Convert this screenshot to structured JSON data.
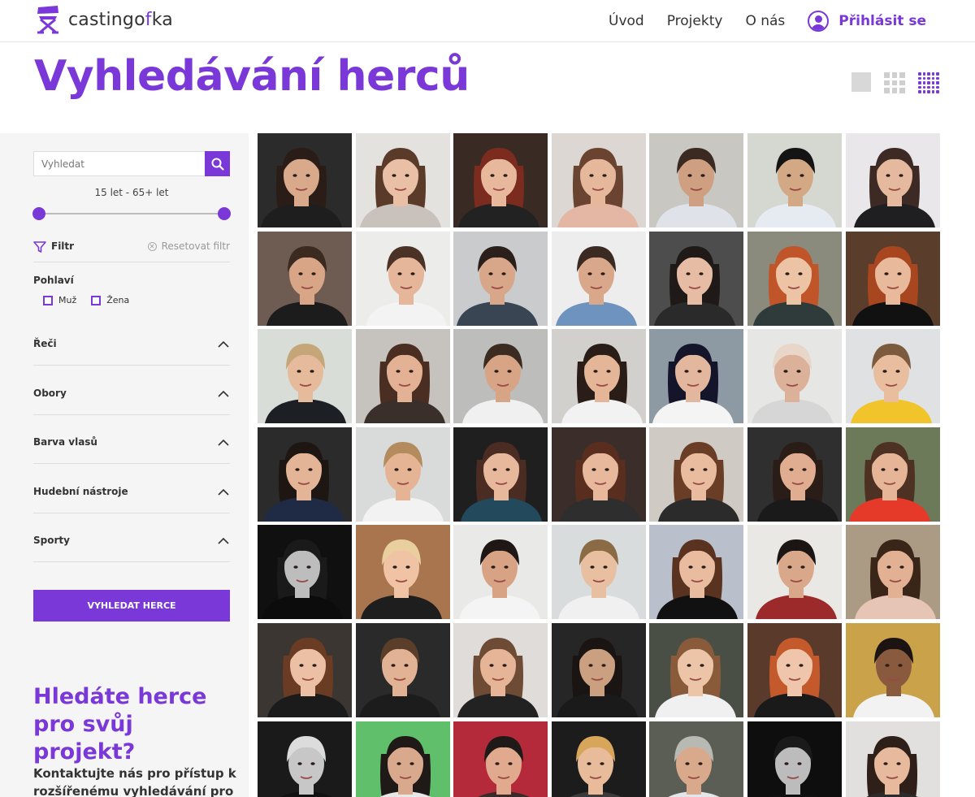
{
  "header": {
    "logo_text_start": "castingo",
    "logo_text_accent": "f",
    "logo_text_end": "ka",
    "nav": [
      "Úvod",
      "Projekty",
      "O nás"
    ],
    "login_label": "Přihlásit se"
  },
  "page": {
    "title": "Vyhledávání herců"
  },
  "sidebar": {
    "search_placeholder": "Vyhledat",
    "age_range": "15 let - 65+ let",
    "age_min": 15,
    "age_max": 65,
    "filter_label": "Filtr",
    "reset_label": "Resetovat filtr",
    "gender_title": "Pohlaví",
    "gender_options": [
      "Muž",
      "Žena"
    ],
    "accordions": [
      "Řeči",
      "Obory",
      "Barva vlasů",
      "Hudební nástroje",
      "Sporty"
    ],
    "cta_label": "VYHLEDAT HERCE",
    "promo_title": "Hledáte herce pro svůj projekt?",
    "promo_text": "Kontaktujte nás pro přístup k rozšířenému vyhledávání pro"
  },
  "colors": {
    "accent": "#7a38d8",
    "sidebar_bg": "#f5f5f5"
  },
  "icons": {
    "search": "search-icon",
    "filter": "filter-icon",
    "reset": "reset-x-icon",
    "login": "user-circle-icon",
    "accordion": "chevron-up-icon",
    "view_large": "view-large-icon",
    "view_medium": "view-grid-3-icon",
    "view_small": "view-grid-5-icon"
  },
  "actors": [
    {
      "bg": "#2b2b2b",
      "skin": "#d9a98c",
      "hair": "#2a1d18",
      "shirt": "#1e1e1e",
      "long": true
    },
    {
      "bg": "#e4e2df",
      "skin": "#e9c0a6",
      "hair": "#5a3b2a",
      "shirt": "#c9c2bc",
      "long": true
    },
    {
      "bg": "#3a2a24",
      "skin": "#e8b89c",
      "hair": "#7c2b1f",
      "shirt": "#222",
      "long": true
    },
    {
      "bg": "#dcd7d2",
      "skin": "#e6b89b",
      "hair": "#6a4430",
      "shirt": "#e4b7a5",
      "long": true
    },
    {
      "bg": "#c8c7c2",
      "skin": "#cf9f82",
      "hair": "#3a2a22",
      "shirt": "#dfe2e8",
      "long": false
    },
    {
      "bg": "#d5d7d1",
      "skin": "#d3a985",
      "hair": "#141414",
      "shirt": "#e6ebf2",
      "long": false
    },
    {
      "bg": "#e9e7ea",
      "skin": "#e5b99e",
      "hair": "#3d2a24",
      "shirt": "#1f1f22",
      "long": true
    },
    {
      "bg": "#6e5c52",
      "skin": "#d9a587",
      "hair": "#3a2a1f",
      "shirt": "#1c1c1c",
      "long": false
    },
    {
      "bg": "#ececea",
      "skin": "#e6b69a",
      "hair": "#4b3226",
      "shirt": "#f3f3f3",
      "long": false
    },
    {
      "bg": "#c9cbcd",
      "skin": "#d8a689",
      "hair": "#2a1f1b",
      "shirt": "#3a4554",
      "long": false
    },
    {
      "bg": "#ededed",
      "skin": "#d9a88a",
      "hair": "#3a2a22",
      "shirt": "#6f93bf",
      "long": false
    },
    {
      "bg": "#4d4d4d",
      "skin": "#e6bca5",
      "hair": "#1f1a18",
      "shirt": "#2a2a2a",
      "long": true
    },
    {
      "bg": "#8a8b7c",
      "skin": "#ecc3a4",
      "hair": "#c0552a",
      "shirt": "#2f3a3a",
      "long": true
    },
    {
      "bg": "#5b3d2c",
      "skin": "#e8b99b",
      "hair": "#a8461f",
      "shirt": "#111",
      "long": true
    },
    {
      "bg": "#d9ddd8",
      "skin": "#e6bb9c",
      "hair": "#c5a679",
      "shirt": "#1c1f24",
      "long": false
    },
    {
      "bg": "#c6c2bd",
      "skin": "#e3b294",
      "hair": "#4b2e22",
      "shirt": "#3a2f2a",
      "long": true
    },
    {
      "bg": "#bdbdbc",
      "skin": "#d8a486",
      "hair": "#3b2b20",
      "shirt": "#f0f0f0",
      "long": false
    },
    {
      "bg": "#d2d0cd",
      "skin": "#e4b596",
      "hair": "#2a1d18",
      "shirt": "#f2f2f2",
      "long": true
    },
    {
      "bg": "#8d9aa4",
      "skin": "#e3b79d",
      "hair": "#14142a",
      "shirt": "#f4f4f4",
      "long": true
    },
    {
      "bg": "#e6e6e5",
      "skin": "#dcb19a",
      "hair": "#e8d7c8",
      "shirt": "#d6d6d6",
      "long": false
    },
    {
      "bg": "#dfe1e3",
      "skin": "#e8be9e",
      "hair": "#7b5a3d",
      "shirt": "#f0c42a",
      "long": false
    },
    {
      "bg": "#2b2b2b",
      "skin": "#e4b496",
      "hair": "#1e1613",
      "shirt": "#1f2b44",
      "long": true
    },
    {
      "bg": "#d9dbdb",
      "skin": "#e5b495",
      "hair": "#b48b5c",
      "shirt": "#f2f2f2",
      "long": false
    },
    {
      "bg": "#1f1f1f",
      "skin": "#e7b89b",
      "hair": "#4a2c22",
      "shirt": "#234a5c",
      "long": true
    },
    {
      "bg": "#3b2e2a",
      "skin": "#e8b89c",
      "hair": "#5a2e1f",
      "shirt": "#2e2e2e",
      "long": true
    },
    {
      "bg": "#cfcac4",
      "skin": "#e9bb9f",
      "hair": "#6a3e26",
      "shirt": "#2b2b2b",
      "long": true
    },
    {
      "bg": "#2f2f2f",
      "skin": "#e0ad90",
      "hair": "#2a1c16",
      "shirt": "#1a1a1a",
      "long": true
    },
    {
      "bg": "#6c7a5a",
      "skin": "#e6b597",
      "hair": "#4d3122",
      "shirt": "#e53a2a",
      "long": true
    },
    {
      "bg": "#101010",
      "skin": "#bdbdbd",
      "hair": "#1a1a1a",
      "shirt": "#0c0c0c",
      "long": true
    },
    {
      "bg": "#a8754f",
      "skin": "#efc3a4",
      "hair": "#e8cf9d",
      "shirt": "#1e1e1e",
      "long": false
    },
    {
      "bg": "#e9e9e7",
      "skin": "#d8a285",
      "hair": "#1f1714",
      "shirt": "#f4f4f4",
      "long": false
    },
    {
      "bg": "#d9dcdc",
      "skin": "#e9bfa2",
      "hair": "#8b6a46",
      "shirt": "#f0f0f0",
      "long": false
    },
    {
      "bg": "#b9bfcb",
      "skin": "#e9bb9f",
      "hair": "#5a3320",
      "shirt": "#111",
      "long": true
    },
    {
      "bg": "#e9e8e5",
      "skin": "#d9a88a",
      "hair": "#1b1613",
      "shirt": "#9c2a2a",
      "long": false
    },
    {
      "bg": "#ab9b85",
      "skin": "#e2b093",
      "hair": "#3a2519",
      "shirt": "#e7c5b6",
      "long": true
    },
    {
      "bg": "#3b3632",
      "skin": "#ecc0a4",
      "hair": "#6a3c24",
      "shirt": "#1b1b1b",
      "long": true
    },
    {
      "bg": "#2a2a2a",
      "skin": "#e2b295",
      "hair": "#5a3e2a",
      "shirt": "#1c1c1c",
      "long": false
    },
    {
      "bg": "#dfdcda",
      "skin": "#e6b496",
      "hair": "#6e4b34",
      "shirt": "#222",
      "long": true
    },
    {
      "bg": "#262626",
      "skin": "#caa081",
      "hair": "#1a1512",
      "shirt": "#1a1a1a",
      "long": true
    },
    {
      "bg": "#4a4f46",
      "skin": "#ecc4a8",
      "hair": "#8a5b3a",
      "shirt": "#f0f0f0",
      "long": true
    },
    {
      "bg": "#5a3a2b",
      "skin": "#efc6ab",
      "hair": "#c45a2c",
      "shirt": "#1a1a1a",
      "long": true
    },
    {
      "bg": "#c9a24a",
      "skin": "#8a5a3f",
      "hair": "#1b1412",
      "shirt": "#f2f2f2",
      "long": false
    },
    {
      "bg": "#1a1a1a",
      "skin": "#c7c7c7",
      "hair": "#dcdcdc",
      "shirt": "#111",
      "long": false
    },
    {
      "bg": "#5fbf6a",
      "skin": "#d9a98d",
      "hair": "#1f1a18",
      "shirt": "#e8e8e8",
      "long": true
    },
    {
      "bg": "#b52a3a",
      "skin": "#e1a98d",
      "hair": "#1f1a18",
      "shirt": "#3a2a2a",
      "long": false
    },
    {
      "bg": "#1c1c1c",
      "skin": "#e8bb9b",
      "hair": "#d8a65a",
      "shirt": "#3a3a3a",
      "long": false
    },
    {
      "bg": "#5a5e54",
      "skin": "#d9a98c",
      "hair": "#b9b9b4",
      "shirt": "#e4e7ea",
      "long": false
    },
    {
      "bg": "#0e0e0e",
      "skin": "#bcbcbc",
      "hair": "#1a1a1a",
      "shirt": "#101010",
      "long": false
    },
    {
      "bg": "#e2e0df",
      "skin": "#e7b99d",
      "hair": "#2e1f19",
      "shirt": "#2b2b2b",
      "long": true
    }
  ]
}
